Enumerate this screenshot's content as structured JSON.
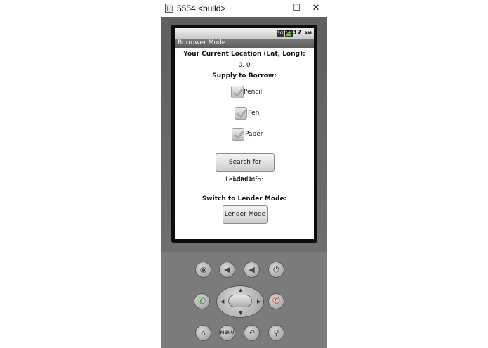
{
  "window": {
    "title": "5554:<build>",
    "minimize": "—",
    "maximize": "☐",
    "close": "✕"
  },
  "device": {
    "status": {
      "signal_icon": "3G",
      "time": "2:37",
      "ampm": "AM"
    },
    "app_title": "Borrower Mode",
    "content": {
      "location_label": "Your Current Location (Lat, Long):",
      "location_value": "0, 0",
      "supply_label": "Supply to Borrow:",
      "supplies": [
        {
          "label": "Pencil",
          "checked": true
        },
        {
          "label": "Pen",
          "checked": true
        },
        {
          "label": "Paper",
          "checked": true
        }
      ],
      "search_button": "Search for Lender!",
      "lender_info": "Lender Info:",
      "switch_label": "Switch to Lender Mode:",
      "lender_mode_button": "Lender Mode"
    },
    "hardware_buttons": {
      "camera": "camera-icon",
      "volume_down": "volume-down-icon",
      "volume_up": "volume-up-icon",
      "power": "power-icon",
      "call": "call-icon",
      "end_call": "end-call-icon",
      "home": "home-icon",
      "menu": "MENU",
      "back": "back-icon",
      "search": "search-icon"
    }
  }
}
